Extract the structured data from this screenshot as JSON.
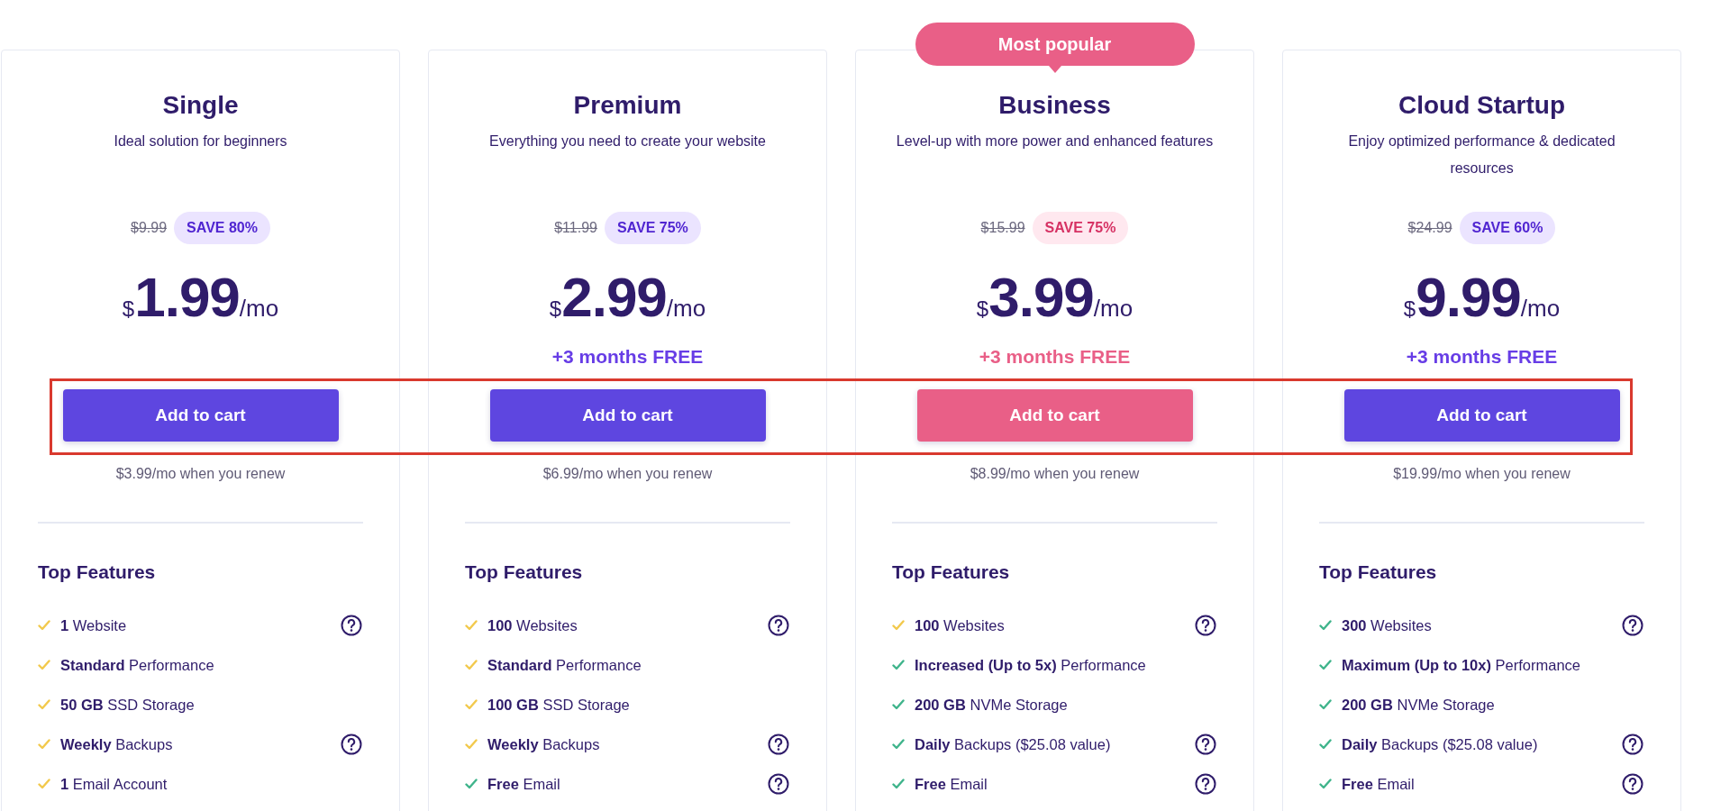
{
  "plans": [
    {
      "name": "Single",
      "subtitle": "Ideal solution for beginners",
      "featured": false,
      "old_price": "$9.99",
      "save": "SAVE 80%",
      "currency": "$",
      "price": "1.99",
      "period": "/mo",
      "button": "Add to cart",
      "renewal": "$3.99/mo when you renew",
      "features_title": "Top Features",
      "features": [
        {
          "text": "**1** Website",
          "color": "#f2c94c",
          "help": true
        },
        {
          "text": "**Standard** Performance",
          "color": "#f2c94c",
          "help": false
        },
        {
          "text": "**50 GB** SSD Storage",
          "color": "#f2c94c",
          "help": false
        },
        {
          "text": "**Weekly** Backups",
          "color": "#f2c94c",
          "help": true
        },
        {
          "text": "**1** Email Account",
          "color": "#f2c94c",
          "help": false
        }
      ]
    },
    {
      "name": "Premium",
      "subtitle": "Everything you need to create your website",
      "featured": false,
      "old_price": "$11.99",
      "save": "SAVE 75%",
      "currency": "$",
      "price": "2.99",
      "period": "/mo",
      "bonus": "+3 months FREE",
      "button": "Add to cart",
      "renewal": "$6.99/mo when you renew",
      "features_title": "Top Features",
      "features": [
        {
          "text": "**100** Websites",
          "color": "#f2c94c",
          "help": true
        },
        {
          "text": "**Standard** Performance",
          "color": "#f2c94c",
          "help": false
        },
        {
          "text": "**100 GB** SSD Storage",
          "color": "#f2c94c",
          "help": false
        },
        {
          "text": "**Weekly** Backups",
          "color": "#f2c94c",
          "help": true
        },
        {
          "text": "**Free** Email",
          "color": "#3fb48b",
          "help": true
        }
      ]
    },
    {
      "name": "Business",
      "badge": "Most popular",
      "subtitle": "Level-up with more power and enhanced features",
      "featured": true,
      "old_price": "$15.99",
      "save": "SAVE 75%",
      "currency": "$",
      "price": "3.99",
      "period": "/mo",
      "bonus": "+3 months FREE",
      "button": "Add to cart",
      "renewal": "$8.99/mo when you renew",
      "features_title": "Top Features",
      "features": [
        {
          "text": "**100** Websites",
          "color": "#f2c94c",
          "help": true
        },
        {
          "text": "**Increased (Up to 5x)** Performance",
          "color": "#3fb48b",
          "help": false
        },
        {
          "text": "**200 GB** NVMe Storage",
          "color": "#3fb48b",
          "help": false
        },
        {
          "text": "**Daily** Backups ($25.08 value)",
          "color": "#3fb48b",
          "help": true
        },
        {
          "text": "**Free** Email",
          "color": "#3fb48b",
          "help": true
        }
      ]
    },
    {
      "name": "Cloud Startup",
      "subtitle": "Enjoy optimized performance & dedicated resources",
      "featured": false,
      "old_price": "$24.99",
      "save": "SAVE 60%",
      "currency": "$",
      "price": "9.99",
      "period": "/mo",
      "bonus": "+3 months FREE",
      "button": "Add to cart",
      "renewal": "$19.99/mo when you renew",
      "features_title": "Top Features",
      "features": [
        {
          "text": "**300** Websites",
          "color": "#3fb48b",
          "help": true
        },
        {
          "text": "**Maximum (Up to 10x)** Performance",
          "color": "#3fb48b",
          "help": false
        },
        {
          "text": "**200 GB** NVMe Storage",
          "color": "#3fb48b",
          "help": false
        },
        {
          "text": "**Daily** Backups ($25.08 value)",
          "color": "#3fb48b",
          "help": true
        },
        {
          "text": "**Free** Email",
          "color": "#3fb48b",
          "help": true
        }
      ]
    }
  ]
}
